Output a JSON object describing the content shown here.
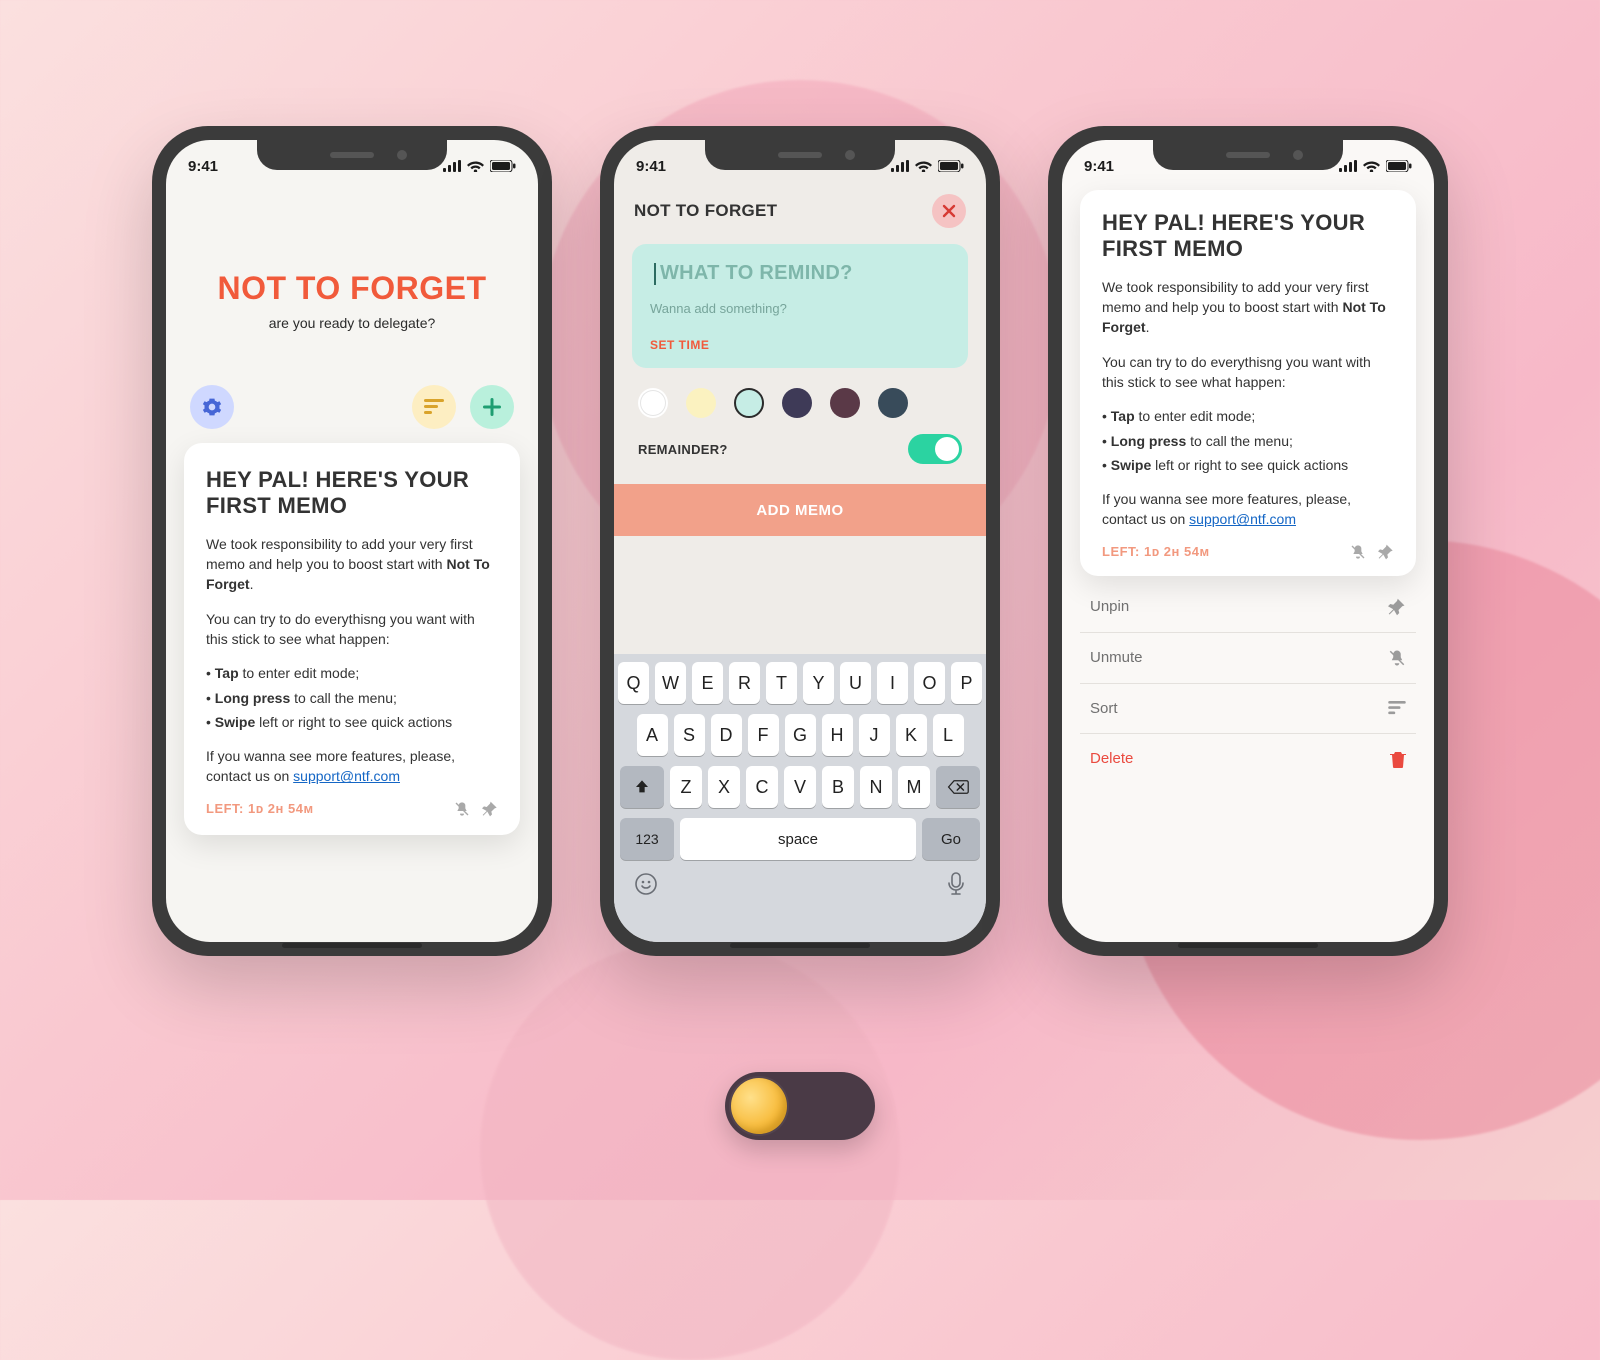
{
  "status": {
    "time": "9:41"
  },
  "screen1": {
    "hero_title": "NOT TO FORGET",
    "hero_sub": "are you ready to delegate?"
  },
  "memo": {
    "title": "HEY PAL! HERE'S YOUR FIRST MEMO",
    "p1a": "We took responsibility to add your very first memo and help you to boost start with ",
    "p1b": "Not To Forget",
    "p2": "You can try to do everythisng you want with this stick to see what happen:",
    "li1a": "Tap",
    "li1b": " to enter edit mode;",
    "li2a": "Long press",
    "li2b": " to call the menu;",
    "li3a": "Swipe",
    "li3b": " left or right to see quick actions",
    "p3": "If you wanna see more features, please, contact us on ",
    "support": "support@ntf.com",
    "left_label": "LEFT: 1ᴅ 2ʜ 54ᴍ"
  },
  "compose": {
    "header": "NOT TO FORGET",
    "title_placeholder": "WHAT TO REMIND?",
    "sub_placeholder": "Wanna add something?",
    "set_time": "SET TIME",
    "remainder_label": "REMAINDER?",
    "add_button": "ADD MEMO",
    "colors": [
      "#ffffff",
      "#fbf2c0",
      "#c6ede5",
      "#3e3a57",
      "#5a3947",
      "#384b5a"
    ],
    "selected_color_index": 2,
    "remainder_on": true
  },
  "keyboard": {
    "row1": [
      "Q",
      "W",
      "E",
      "R",
      "T",
      "Y",
      "U",
      "I",
      "O",
      "P"
    ],
    "row2": [
      "A",
      "S",
      "D",
      "F",
      "G",
      "H",
      "J",
      "K",
      "L"
    ],
    "row3": [
      "Z",
      "X",
      "C",
      "V",
      "B",
      "N",
      "M"
    ],
    "num": "123",
    "space": "space",
    "go": "Go"
  },
  "menu": {
    "unpin": "Unpin",
    "unmute": "Unmute",
    "sort": "Sort",
    "delete": "Delete"
  }
}
